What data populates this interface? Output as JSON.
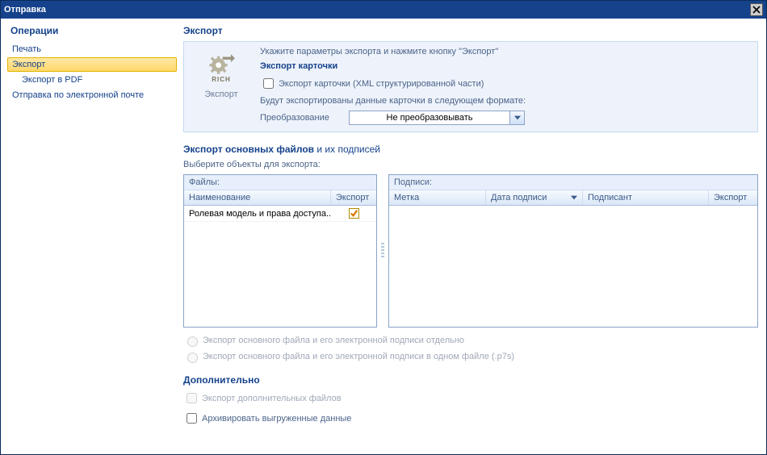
{
  "window": {
    "title": "Отправка"
  },
  "sidebar": {
    "title": "Операции",
    "items": [
      {
        "label": "Печать"
      },
      {
        "label": "Экспорт"
      },
      {
        "label": "Экспорт в PDF"
      },
      {
        "label": "Отправка по электронной почте"
      }
    ]
  },
  "main": {
    "title": "Экспорт",
    "icon_caption": "Экспорт",
    "icon_tag": "RICH",
    "hint": "Укажите параметры экспорта и нажмите кнопку \"Экспорт\"",
    "card": {
      "title": "Экспорт карточки",
      "checkbox_label": "Экспорт карточки (XML структурированной части)",
      "desc": "Будут экспортированы данные карточки в следующем формате:",
      "transform_label": "Преобразование",
      "transform_value": "Не преобразовывать"
    },
    "files_section": {
      "title_a": "Экспорт основных файлов",
      "title_b": " и их подписей",
      "subdesc": "Выберите объекты для экспорта:",
      "files_panel": {
        "caption": "Файлы:",
        "cols": {
          "name": "Наименование",
          "export": "Экспорт"
        },
        "row0": {
          "name": "Ролевая модель и права доступа..."
        }
      },
      "sigs_panel": {
        "caption": "Подписи:",
        "cols": {
          "mark": "Метка",
          "date": "Дата подписи",
          "signer": "Подписант",
          "export": "Экспорт"
        }
      },
      "radio1": "Экспорт основного файла и его электронной подписи отдельно",
      "radio2": "Экспорт основного файла и его электронной подписи в одном файле (.p7s)"
    },
    "extra": {
      "title": "Дополнительно",
      "chk1": "Экспорт дополнительных  файлов",
      "chk2": "Архивировать выгруженные данные"
    }
  }
}
